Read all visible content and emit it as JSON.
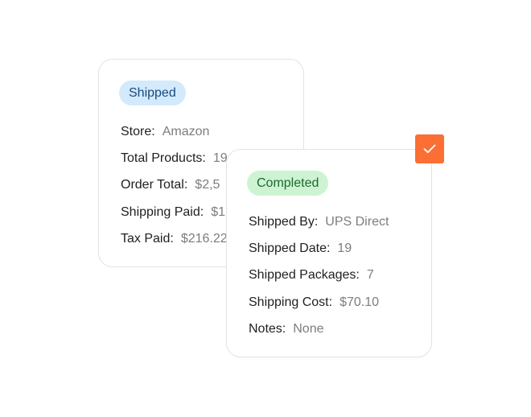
{
  "shipped_card": {
    "status": "Shipped",
    "rows": [
      {
        "label": "Store:",
        "value": "Amazon"
      },
      {
        "label": "Total Products:",
        "value": "19"
      },
      {
        "label": "Order Total:",
        "value": "$2,5"
      },
      {
        "label": "Shipping Paid:",
        "value": "$1"
      },
      {
        "label": "Tax Paid:",
        "value": "$216.22"
      }
    ]
  },
  "completed_card": {
    "status": "Completed",
    "rows": [
      {
        "label": "Shipped By:",
        "value": "UPS Direct"
      },
      {
        "label": "Shipped Date:",
        "value": "19"
      },
      {
        "label": "Shipped Packages:",
        "value": "7"
      },
      {
        "label": "Shipping Cost:",
        "value": "$70.10"
      },
      {
        "label": "Notes:",
        "value": "None"
      }
    ]
  },
  "check_badge": {
    "icon": "checkmark-icon",
    "color": "#FB6F35"
  },
  "colors": {
    "shipped_badge_bg": "#D3EAFC",
    "completed_badge_bg": "#CDF3D3",
    "accent": "#FB6F35"
  }
}
